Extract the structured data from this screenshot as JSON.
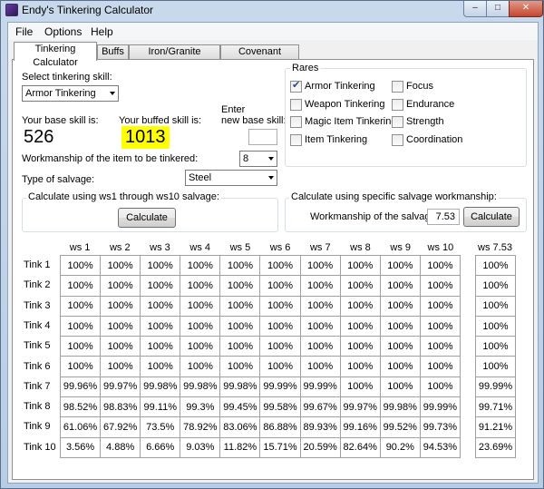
{
  "window": {
    "title": "Endy's Tinkering Calculator",
    "minimize": "–",
    "maximize": "□",
    "close": "✕"
  },
  "menu": [
    "File",
    "Options",
    "Help"
  ],
  "tabs": [
    "Tinkering Calculator",
    "Buffs",
    "Iron/Granite Calculator",
    "Covenant Planner"
  ],
  "skill": {
    "select_label": "Select tinkering skill:",
    "selected": "Armor Tinkering",
    "base_label": "Your base skill is:",
    "base_value": "526",
    "buffed_label": "Your buffed skill is:",
    "buffed_value": "1013",
    "enter_label_1": "Enter",
    "enter_label_2": "new base skill:",
    "enter_value": ""
  },
  "workmanship": {
    "label": "Workmanship of the item to be tinkered:",
    "value": "8"
  },
  "salvage": {
    "label": "Type of salvage:",
    "value": "Steel"
  },
  "rares": {
    "title": "Rares",
    "items": [
      {
        "label": "Armor Tinkering",
        "checked": true
      },
      {
        "label": "Weapon Tinkering",
        "checked": false
      },
      {
        "label": "Magic Item Tinkering",
        "checked": false
      },
      {
        "label": "Item Tinkering",
        "checked": false
      },
      {
        "label": "Focus",
        "checked": false
      },
      {
        "label": "Endurance",
        "checked": false
      },
      {
        "label": "Strength",
        "checked": false
      },
      {
        "label": "Coordination",
        "checked": false
      }
    ]
  },
  "calc_range": {
    "title": "Calculate using ws1 through ws10 salvage:",
    "button": "Calculate"
  },
  "calc_specific": {
    "title": "Calculate using specific salvage workmanship:",
    "label": "Workmanship of the salvage:",
    "value": "7.53",
    "button": "Calculate"
  },
  "grid": {
    "columns": [
      "ws 1",
      "ws 2",
      "ws 3",
      "ws 4",
      "ws 5",
      "ws 6",
      "ws 7",
      "ws 8",
      "ws 9",
      "ws 10"
    ],
    "rows": [
      "Tink 1",
      "Tink 2",
      "Tink 3",
      "Tink 4",
      "Tink 5",
      "Tink 6",
      "Tink 7",
      "Tink 8",
      "Tink 9",
      "Tink 10"
    ],
    "cells": [
      [
        "100%",
        "100%",
        "100%",
        "100%",
        "100%",
        "100%",
        "100%",
        "100%",
        "100%",
        "100%"
      ],
      [
        "100%",
        "100%",
        "100%",
        "100%",
        "100%",
        "100%",
        "100%",
        "100%",
        "100%",
        "100%"
      ],
      [
        "100%",
        "100%",
        "100%",
        "100%",
        "100%",
        "100%",
        "100%",
        "100%",
        "100%",
        "100%"
      ],
      [
        "100%",
        "100%",
        "100%",
        "100%",
        "100%",
        "100%",
        "100%",
        "100%",
        "100%",
        "100%"
      ],
      [
        "100%",
        "100%",
        "100%",
        "100%",
        "100%",
        "100%",
        "100%",
        "100%",
        "100%",
        "100%"
      ],
      [
        "100%",
        "100%",
        "100%",
        "100%",
        "100%",
        "100%",
        "100%",
        "100%",
        "100%",
        "100%"
      ],
      [
        "99.96%",
        "99.97%",
        "99.98%",
        "99.98%",
        "99.98%",
        "99.99%",
        "99.99%",
        "100%",
        "100%",
        "100%"
      ],
      [
        "98.52%",
        "98.83%",
        "99.11%",
        "99.3%",
        "99.45%",
        "99.58%",
        "99.67%",
        "99.97%",
        "99.98%",
        "99.99%"
      ],
      [
        "61.06%",
        "67.92%",
        "73.5%",
        "78.92%",
        "83.06%",
        "86.88%",
        "89.93%",
        "99.16%",
        "99.52%",
        "99.73%"
      ],
      [
        "3.56%",
        "4.88%",
        "6.66%",
        "9.03%",
        "11.82%",
        "15.71%",
        "20.59%",
        "82.64%",
        "90.2%",
        "94.53%"
      ]
    ],
    "specific_column": "ws 7.53",
    "specific_cells": [
      "100%",
      "100%",
      "100%",
      "100%",
      "100%",
      "100%",
      "99.99%",
      "99.71%",
      "91.21%",
      "23.69%"
    ]
  }
}
